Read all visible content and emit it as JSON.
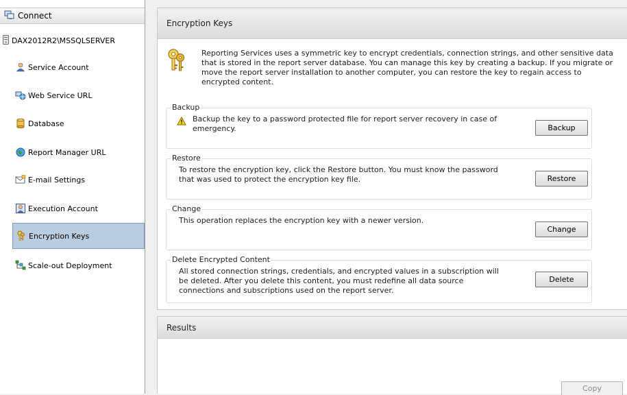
{
  "nav": {
    "connect_label": "Connect",
    "server_label": "DAX2012R2\\MSSQLSERVER",
    "items": [
      {
        "label": "Service Account"
      },
      {
        "label": "Web Service URL"
      },
      {
        "label": "Database"
      },
      {
        "label": "Report Manager URL"
      },
      {
        "label": "E-mail Settings"
      },
      {
        "label": "Execution Account"
      },
      {
        "label": "Encryption Keys"
      },
      {
        "label": "Scale-out Deployment"
      }
    ],
    "selected": "Encryption Keys"
  },
  "main": {
    "title": "Encryption Keys",
    "intro": "Reporting Services uses a symmetric key to encrypt credentials, connection strings, and other sensitive data that is stored in the report server database.  You can manage this key by creating a backup.  If you migrate or move the report server installation to another computer, you can restore the key to regain access to encrypted content.",
    "groups": {
      "backup": {
        "title": "Backup",
        "text": "Backup the key to a password protected file for report server recovery in case of emergency.",
        "button": "Backup"
      },
      "restore": {
        "title": "Restore",
        "text": "To restore the encryption key, click the Restore button.  You must know the password that was used to protect the encryption key file.",
        "button": "Restore"
      },
      "change": {
        "title": "Change",
        "text": "This operation replaces the encryption key with a newer version.",
        "button": "Change"
      },
      "delete": {
        "title": "Delete Encrypted Content",
        "text": "All stored connection strings, credentials, and encrypted values in a subscription will be deleted.  After you delete this content, you must redefine all data source connections and subscriptions used on the report server.",
        "button": "Delete"
      }
    }
  },
  "results": {
    "title": "Results",
    "copy_label": "Copy"
  },
  "colors": {
    "selected_bg": "#b9cce0",
    "selected_border": "#7a99bb",
    "group_border": "#d5dfe5"
  }
}
